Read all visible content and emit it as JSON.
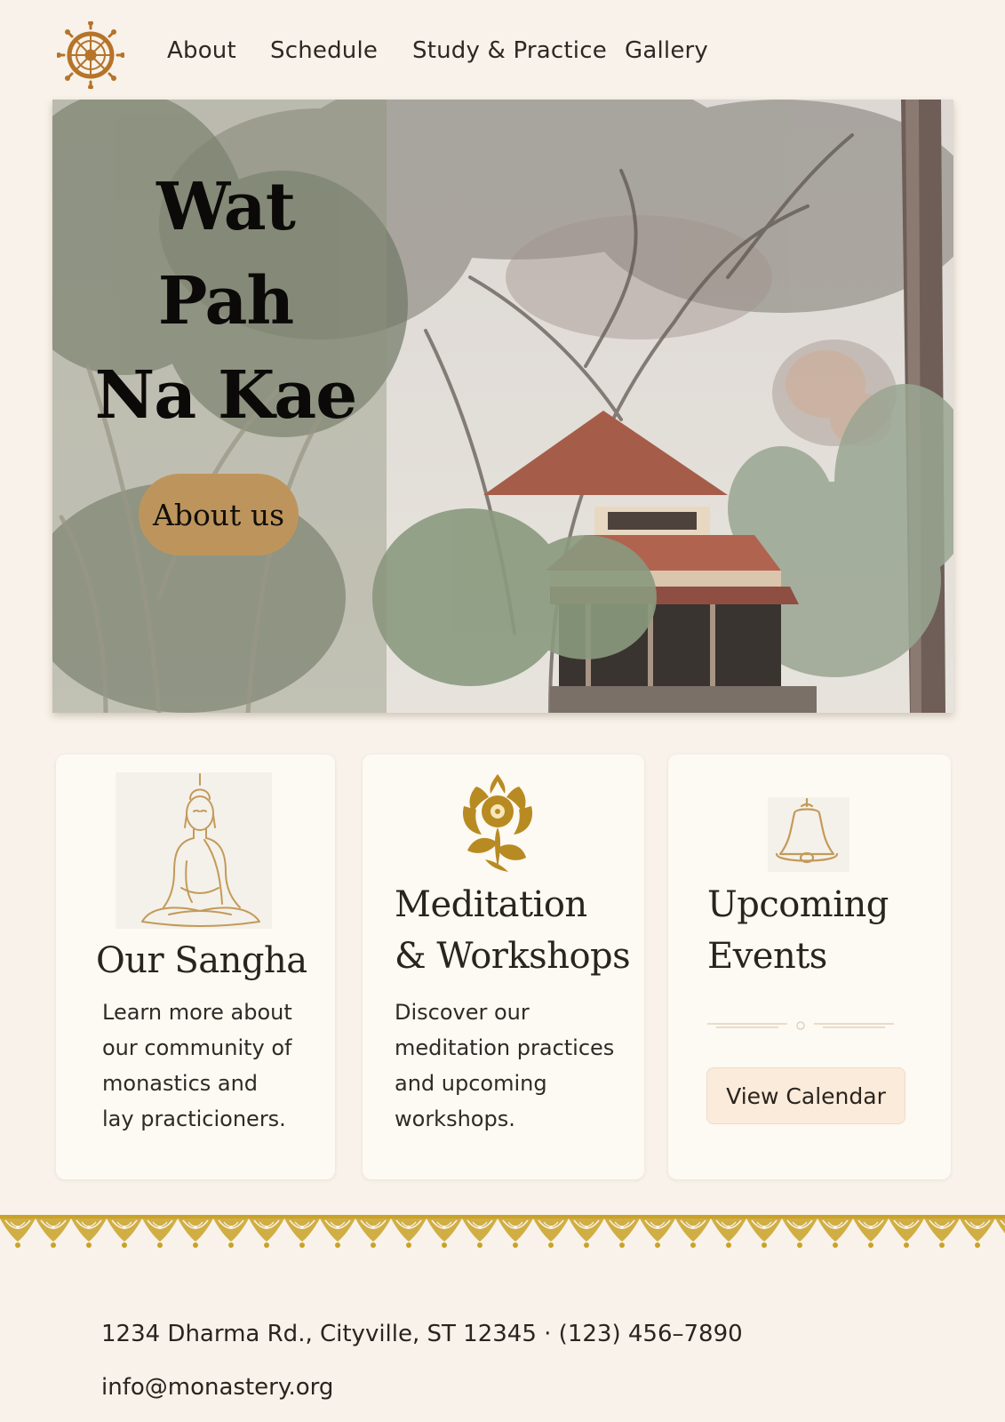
{
  "nav": {
    "logo_icon": "dharma-wheel-icon",
    "links": [
      {
        "label": "About"
      },
      {
        "label": "Schedule"
      },
      {
        "label": "Study & Practice"
      },
      {
        "label": "Gallery"
      }
    ]
  },
  "hero": {
    "title_line1": "Wat Pah",
    "title_line2": "Na Kae",
    "button_label": "About us",
    "image_icon": "temple-forest-photo"
  },
  "cards": [
    {
      "icon": "buddha-icon",
      "title": "Our Sangha",
      "text": "Learn more about\nour community of\nmonastics and\nlay practicioners."
    },
    {
      "icon": "lotus-flower-icon",
      "title_line1": "Meditation",
      "title_line2": "& Workshops",
      "text": "Discover our\nmeditation practices\nand upcoming\nworkshops."
    },
    {
      "icon": "bell-icon",
      "title_line1": "Upcoming",
      "title_line2": "Events",
      "button_label": "View Calendar"
    }
  ],
  "footer": {
    "address": "1234 Dharma Rd., Cityville, ST 12345 · (123) 456–7890",
    "email": "info@monastery.org"
  },
  "colors": {
    "background": "#f8f2ea",
    "accent_gold": "#bd955c",
    "border_gold": "#c9a227",
    "card": "#fdf9f3"
  }
}
